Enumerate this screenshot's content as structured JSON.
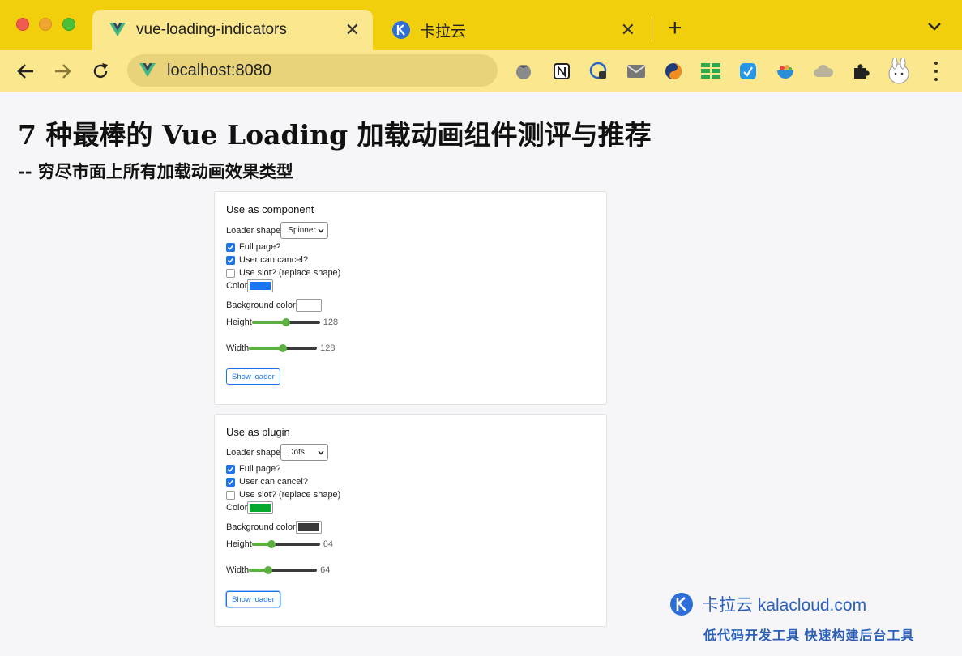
{
  "browser": {
    "tabs": [
      {
        "title": "vue-loading-indicators",
        "active": true,
        "icon": "vue-logo-icon"
      },
      {
        "title": "卡拉云",
        "active": false,
        "icon": "kalacloud-logo-icon"
      }
    ],
    "close_glyph": "✕",
    "new_tab_glyph": "+",
    "url": "localhost:8080",
    "extensions": [
      "tomato-icon",
      "notion-icon",
      "lock-badge-icon",
      "mail-icon",
      "swirl-icon",
      "grid-icon",
      "cube-icon",
      "bowl-icon",
      "cloud-icon",
      "puzzle-icon",
      "bunny-avatar-icon"
    ],
    "accent_color": "#f2cf0c"
  },
  "page": {
    "title": "7 种最棒的 Vue Loading 加载动画组件测评与推荐",
    "subtitle": "-- 穷尽市面上所有加载动画效果类型"
  },
  "component_card": {
    "title": "Use as component",
    "loader_shape_label": "Loader shape",
    "loader_shape_value": "Spinner",
    "full_page_label": "Full page?",
    "full_page_checked": true,
    "cancel_label": "User can cancel?",
    "cancel_checked": true,
    "slot_label": "Use slot? (replace shape)",
    "slot_checked": false,
    "color_label": "Color",
    "color_value": "#1a76f0",
    "bg_color_label": "Background color",
    "bg_color_value": "#ffffff",
    "height_label": "Height",
    "height_value": "128",
    "height_fraction": 0.5,
    "width_label": "Width",
    "width_value": "128",
    "width_fraction": 0.5,
    "button_label": "Show loader"
  },
  "plugin_card": {
    "title": "Use as plugin",
    "loader_shape_label": "Loader shape",
    "loader_shape_value": "Dots",
    "full_page_label": "Full page?",
    "full_page_checked": true,
    "cancel_label": "User can cancel?",
    "cancel_checked": true,
    "slot_label": "Use slot? (replace shape)",
    "slot_checked": false,
    "color_label": "Color",
    "color_value": "#06a82c",
    "bg_color_label": "Background color",
    "bg_color_value": "#3a3a3a",
    "height_label": "Height",
    "height_value": "64",
    "height_fraction": 0.25,
    "width_label": "Width",
    "width_value": "64",
    "width_fraction": 0.25,
    "button_label": "Show loader"
  },
  "watermark": {
    "line1": "卡拉云 kalacloud.com",
    "line2": "低代码开发工具 快速构建后台工具"
  }
}
